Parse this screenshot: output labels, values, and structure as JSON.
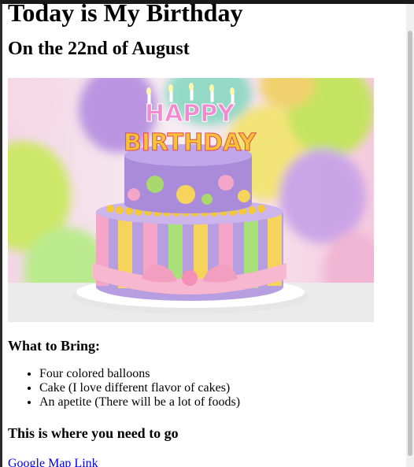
{
  "page": {
    "title": "Today is My Birthday",
    "subtitle": "On the 22nd of August",
    "bring_heading": "What to Bring:",
    "bring_items": [
      "Four colored balloons",
      "Cake (I love different flavor of cakes)",
      "An apetite (There will be a lot of foods)"
    ],
    "where_heading": "This is where you need to go",
    "map_link": "Google Map Link"
  },
  "image": {
    "topper_line1": "HAPPY",
    "topper_line2": "BIRTHDAY"
  },
  "colors": {
    "link": "#0000ee",
    "text": "#000000",
    "background": "#ffffff"
  }
}
